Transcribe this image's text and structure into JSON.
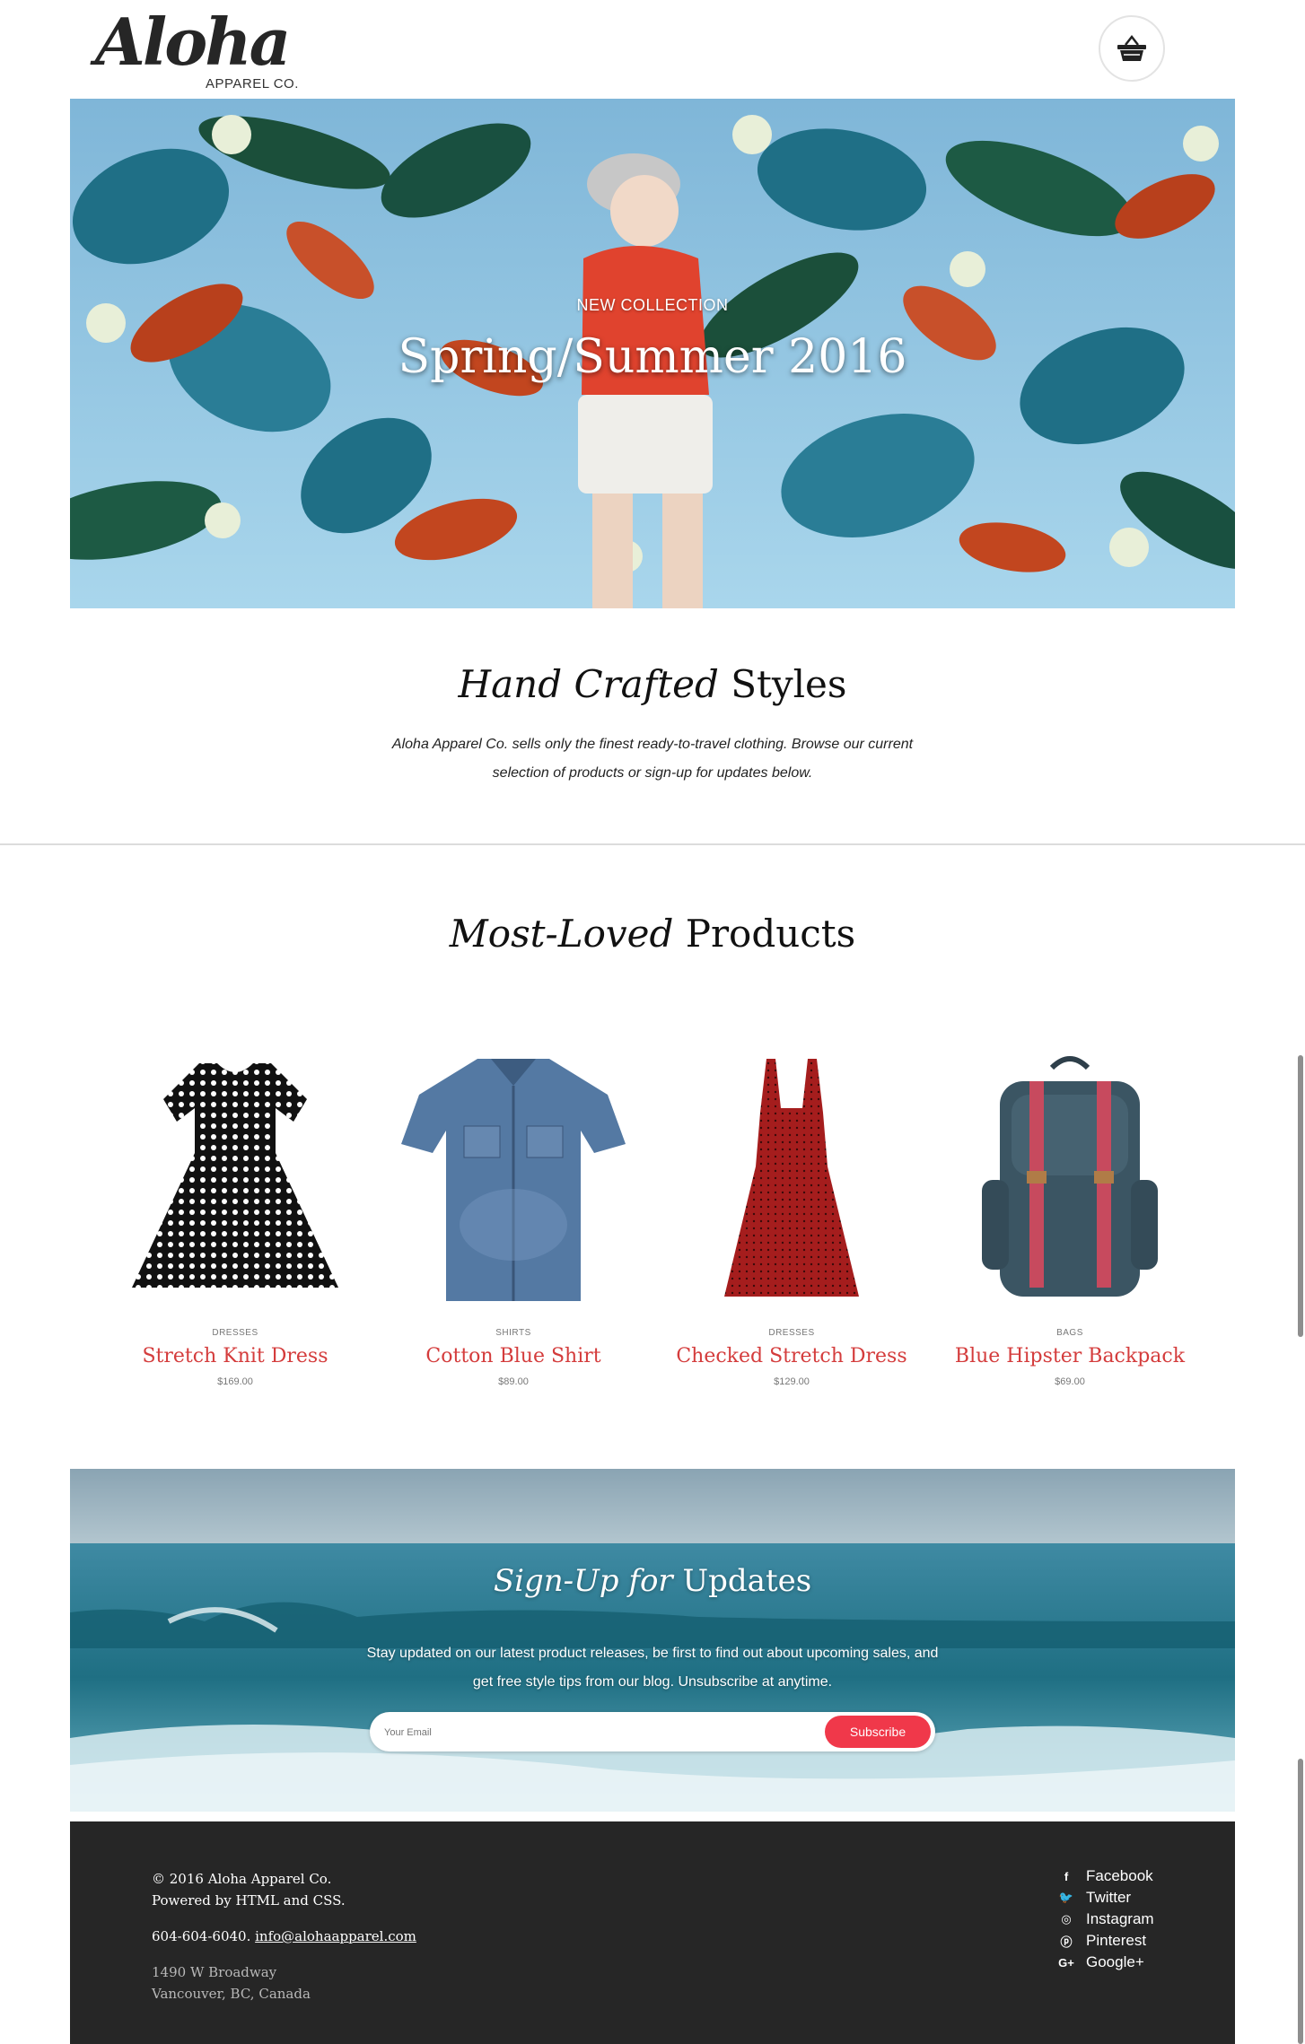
{
  "brand": {
    "logo_script": "Aloha",
    "logo_sub": "APPAREL CO."
  },
  "header": {
    "cart_icon": "basket-icon"
  },
  "hero": {
    "kicker": "NEW COLLECTION",
    "title": "Spring/Summer 2016"
  },
  "intro": {
    "title_italic": "Hand Crafted",
    "title_rest": "Styles",
    "text": "Aloha Apparel Co. sells only the finest ready-to-travel clothing. Browse our current selection of products or sign-up for updates below."
  },
  "products": {
    "title_italic": "Most-Loved",
    "title_rest": "Products",
    "items": [
      {
        "category": "DRESSES",
        "name": "Stretch Knit Dress",
        "price": "$169.00",
        "icon": "polka-dot-dress-image"
      },
      {
        "category": "SHIRTS",
        "name": "Cotton Blue Shirt",
        "price": "$89.00",
        "icon": "denim-shirt-image"
      },
      {
        "category": "DRESSES",
        "name": "Checked Stretch Dress",
        "price": "$129.00",
        "icon": "red-dress-image"
      },
      {
        "category": "BAGS",
        "name": "Blue Hipster Backpack",
        "price": "$69.00",
        "icon": "backpack-image"
      }
    ]
  },
  "signup": {
    "title_italic": "Sign-Up for",
    "title_rest": "Updates",
    "text": "Stay updated on our latest product releases, be first to find out about upcoming sales, and get free style tips from our blog. Unsubscribe at anytime.",
    "email_placeholder": "Your Email",
    "button_label": "Subscribe"
  },
  "footer": {
    "copyright": "© 2016 Aloha Apparel Co.",
    "powered": "Powered by HTML and CSS.",
    "phone": "604-604-6040.",
    "email": "info@alohaapparel.com",
    "address1": "1490 W Broadway",
    "address2": "Vancouver, BC, Canada",
    "social": [
      {
        "label": "Facebook",
        "glyph": "f",
        "icon": "facebook-icon"
      },
      {
        "label": "Twitter",
        "glyph": "🐦",
        "icon": "twitter-icon"
      },
      {
        "label": "Instagram",
        "glyph": "◎",
        "icon": "instagram-icon"
      },
      {
        "label": "Pinterest",
        "glyph": "ⓟ",
        "icon": "pinterest-icon"
      },
      {
        "label": "Google+",
        "glyph": "G+",
        "icon": "google-plus-icon"
      }
    ]
  },
  "colors": {
    "accent": "#f0384a",
    "product_name": "#d43c3c",
    "footer_bg": "#262626"
  }
}
